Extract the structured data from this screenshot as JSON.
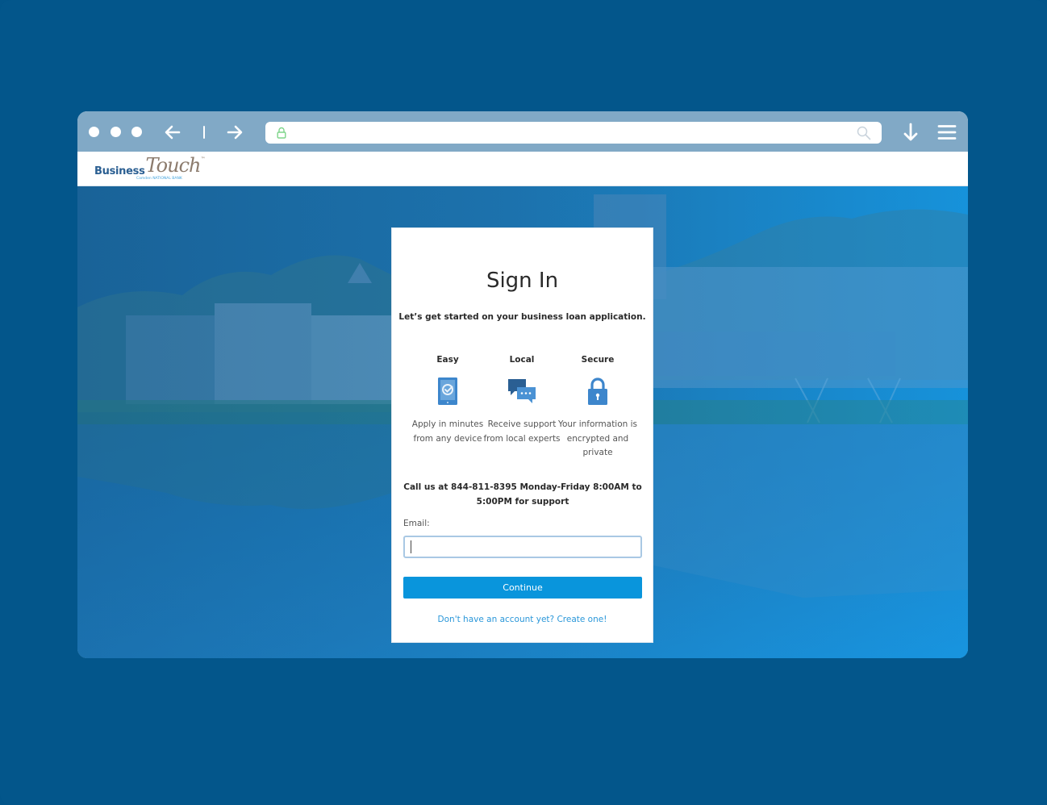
{
  "browser": {
    "address_bar": {
      "value": "",
      "placeholder": ""
    },
    "icons": {
      "window_dots": [
        "window-dot",
        "window-dot",
        "window-dot"
      ],
      "back": "arrow-left-icon",
      "forward": "arrow-right-icon",
      "secure": "lock-icon",
      "search": "search-icon",
      "download": "download-arrow-icon",
      "menu": "hamburger-menu-icon"
    },
    "colors": {
      "frame_background": "#03568b",
      "chrome_bar": "#81a9c6",
      "secure_lock": "#7ed58a"
    }
  },
  "site": {
    "logo": {
      "business": "Business",
      "touch": "Touch",
      "tm": "™",
      "subline": "Camden NATIONAL BANK"
    }
  },
  "signin": {
    "title": "Sign In",
    "subtitle": "Let’s get started on your business loan application.",
    "features": [
      {
        "title": "Easy",
        "icon": "tablet-check-icon",
        "description": "Apply in minutes from any device"
      },
      {
        "title": "Local",
        "icon": "chat-bubbles-icon",
        "description": "Receive support from local experts"
      },
      {
        "title": "Secure",
        "icon": "padlock-icon",
        "description": "Your information is encrypted and private"
      }
    ],
    "call_text": "Call us at 844-811-8395 Monday-Friday 8:00AM to 5:00PM for support",
    "email_label": "Email:",
    "email_value": "",
    "email_placeholder": "",
    "continue_label": "Continue",
    "create_account_link": "Don't have an account yet? Create one!",
    "colors": {
      "primary_button": "#0995dc",
      "link": "#2a97d9",
      "icon_blue": "#3d86cc",
      "icon_dark": "#2a5f93"
    }
  }
}
